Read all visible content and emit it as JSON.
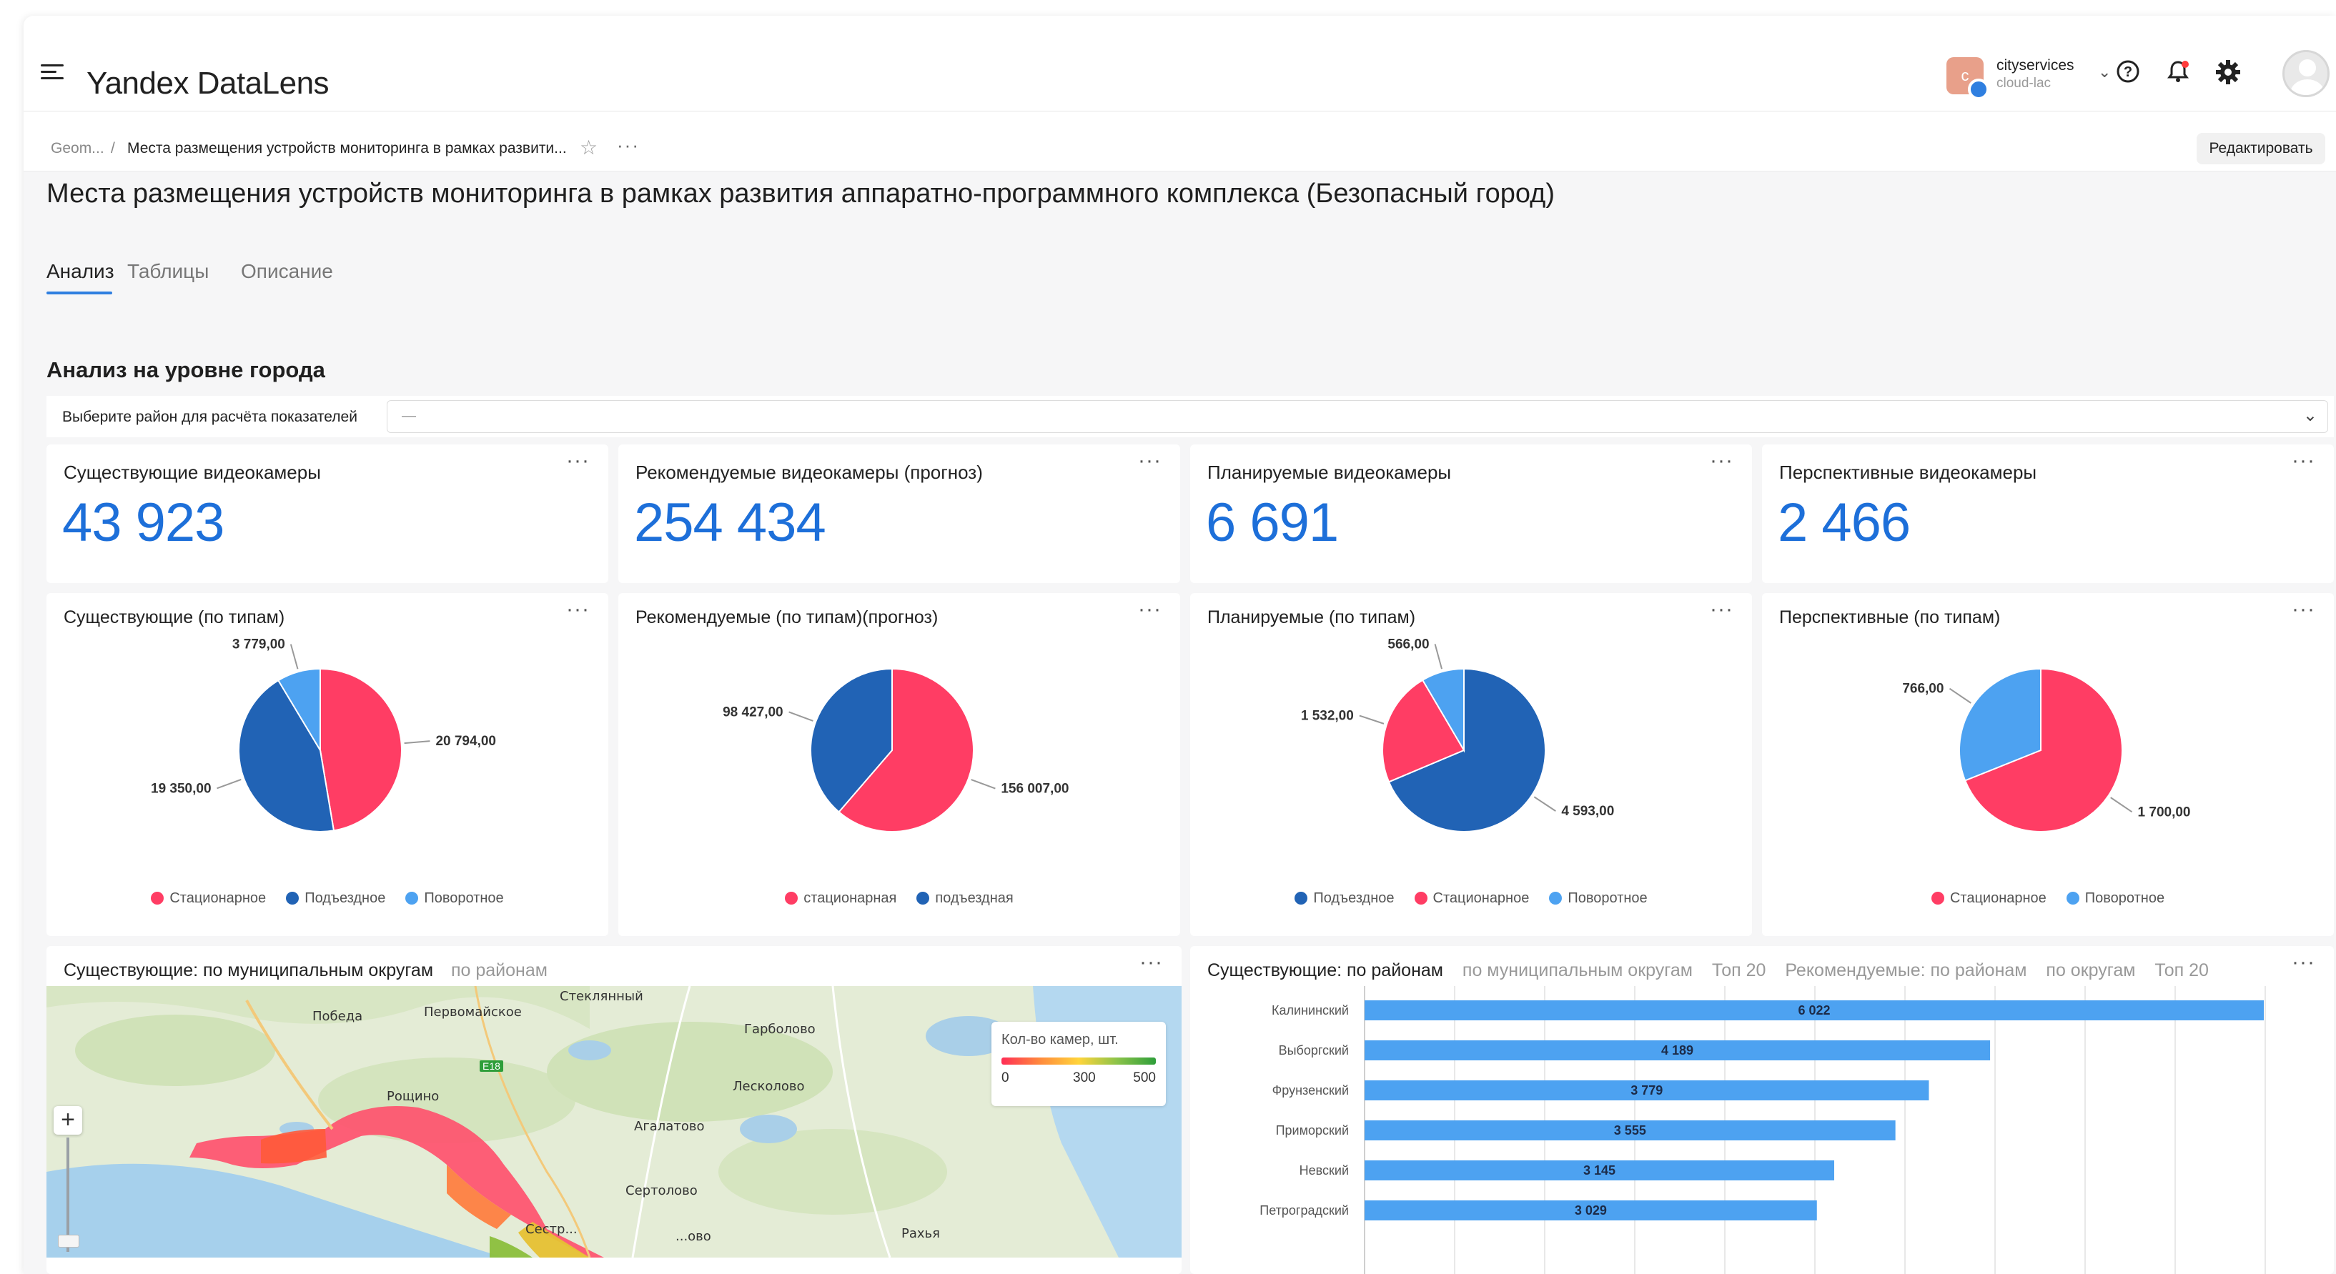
{
  "header": {
    "logo_yandex": "Yandex",
    "logo_datalens": "DataLens",
    "account_initial": "c",
    "account_name": "cityservices",
    "account_sub": "cloud-lac"
  },
  "breadcrumb": {
    "root": "Geom...",
    "separator": "/",
    "current": "Места размещения устройств мониторинга в рамках развити...",
    "edit_label": "Редактировать"
  },
  "page": {
    "title": "Места размещения устройств мониторинга в рамках развития аппаратно-программного комплекса (Безопасный город)",
    "tabs": [
      {
        "label": "Анализ",
        "active": true
      },
      {
        "label": "Таблицы",
        "active": false
      },
      {
        "label": "Описание",
        "active": false
      }
    ],
    "section_title": "Анализ на уровне города",
    "selector_label": "Выберите район для расчёта показателей",
    "selector_value": "—"
  },
  "kpis": [
    {
      "title": "Существующие видеокамеры",
      "value": "43 923"
    },
    {
      "title": "Рекомендуемые видеокамеры (прогноз)",
      "value": "254 434"
    },
    {
      "title": "Планируемые видеокамеры",
      "value": "6 691"
    },
    {
      "title": "Перспективные видеокамеры",
      "value": "2 466"
    }
  ],
  "colors": {
    "red": "#ff3d64",
    "dark_blue": "#2163b5",
    "light_blue": "#4da2f1",
    "accent": "#1d6fd9",
    "bar": "#4da2f1"
  },
  "chart_data": [
    {
      "type": "pie",
      "title": "Существующие (по типам)",
      "series": [
        {
          "name": "Стационарное",
          "value": 20794,
          "label": "20 794,00",
          "color": "#ff3d64"
        },
        {
          "name": "Подъездное",
          "value": 19350,
          "label": "19 350,00",
          "color": "#2163b5"
        },
        {
          "name": "Поворотное",
          "value": 3779,
          "label": "3 779,00",
          "color": "#4da2f1"
        }
      ]
    },
    {
      "type": "pie",
      "title": "Рекомендуемые (по типам)(прогноз)",
      "series": [
        {
          "name": "стационарная",
          "value": 156007,
          "label": "156 007,00",
          "color": "#ff3d64"
        },
        {
          "name": "подъездная",
          "value": 98427,
          "label": "98 427,00",
          "color": "#2163b5"
        }
      ]
    },
    {
      "type": "pie",
      "title": "Планируемые (по типам)",
      "series": [
        {
          "name": "Подъездное",
          "value": 4593,
          "label": "4 593,00",
          "color": "#2163b5"
        },
        {
          "name": "Стационарное",
          "value": 1532,
          "label": "1 532,00",
          "color": "#ff3d64"
        },
        {
          "name": "Поворотное",
          "value": 566,
          "label": "566,00",
          "color": "#4da2f1"
        }
      ]
    },
    {
      "type": "pie",
      "title": "Перспективные (по типам)",
      "series": [
        {
          "name": "Стационарное",
          "value": 1700,
          "label": "1 700,00",
          "color": "#ff3d64"
        },
        {
          "name": "Поворотное",
          "value": 766,
          "label": "766,00",
          "color": "#4da2f1"
        }
      ]
    },
    {
      "type": "bar",
      "orientation": "horizontal",
      "categories": [
        "Калининский",
        "Выборгский",
        "Фрунзенский",
        "Приморский",
        "Невский",
        "Петроградский"
      ],
      "values": [
        6022,
        4189,
        3779,
        3555,
        3145,
        3029
      ],
      "labels": [
        "6 022",
        "4 189",
        "3 779",
        "3 555",
        "3 145",
        "3 029"
      ],
      "xlim": [
        0,
        6000
      ],
      "grid": true
    }
  ],
  "map_card": {
    "tab_active": "Существующие: по муниципальным округам",
    "tab_other": "по районам",
    "legend_title": "Кол-во камер, шт.",
    "legend_ticks": [
      "0",
      "300",
      "500"
    ],
    "zoom_in": "+",
    "road_tag": "E18",
    "places": [
      "Стеклянный",
      "Победа",
      "Первомайское",
      "Гарболово",
      "Лесколово",
      "Рощино",
      "Агалатово",
      "Сертолово",
      "Сестр...",
      "...ово",
      "Рахья"
    ]
  },
  "bar_card": {
    "tabs": [
      {
        "label": "Существующие: по районам",
        "active": true
      },
      {
        "label": "по муниципальным округам",
        "active": false
      },
      {
        "label": "Топ 20",
        "active": false
      },
      {
        "label": "Рекомендуемые: по районам",
        "active": false
      },
      {
        "label": "по округам",
        "active": false
      },
      {
        "label": "Топ 20",
        "active": false
      }
    ]
  }
}
